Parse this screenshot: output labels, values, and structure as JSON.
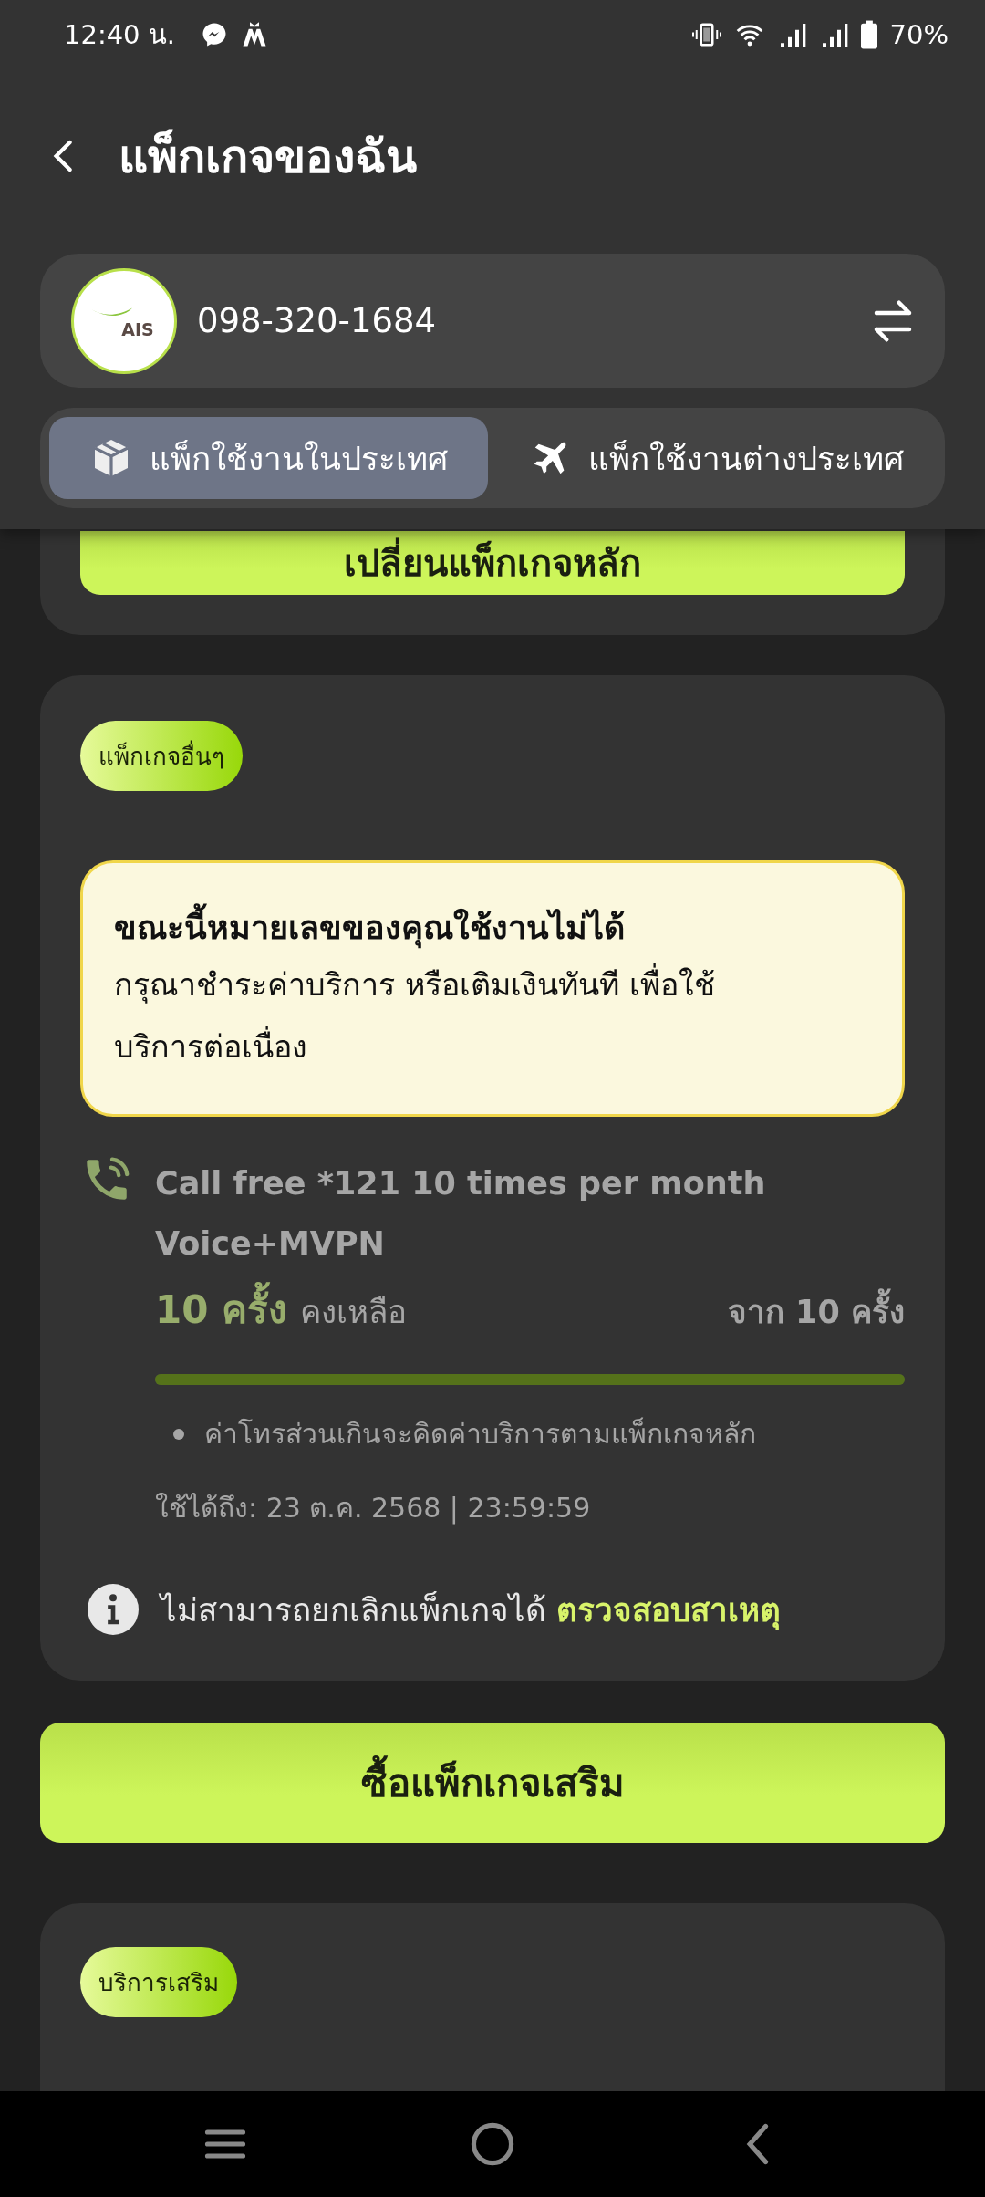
{
  "status_bar": {
    "time": "12:40 น.",
    "battery": "70%"
  },
  "header": {
    "title": "แพ็กเกจของฉัน"
  },
  "account": {
    "logo_text": "AIS",
    "phone": "098-320-1684"
  },
  "tabs": [
    {
      "label": "แพ็กใช้งานในประเทศ",
      "selected": true
    },
    {
      "label": "แพ็กใช้งานต่างประเทศ",
      "selected": false
    }
  ],
  "main_package_button": "เปลี่ยนแพ็กเกจหลัก",
  "other_packages": {
    "badge": "แพ็กเกจอื่นๆ",
    "alert": {
      "title": "ขณะนี้หมายเลขของคุณใช้งานไม่ได้",
      "message": "กรุณาชำระค่าบริการ หรือเติมเงินทันที เพื่อใช้บริการต่อเนื่อง"
    },
    "package": {
      "name": "Call free *121 10 times per month",
      "type": "Voice+MVPN",
      "remaining": "10 ครั้ง",
      "remaining_label": "คงเหลือ",
      "total": "จาก 10 ครั้ง",
      "level": 1,
      "notes": [
        "ค่าโทรส่วนเกินจะคิดค่าบริการตามแพ็กเกจหลัก"
      ],
      "valid_until": "ใช้ได้ถึง: 23 ต.ค. 2568 | 23:59:59"
    },
    "cancel_note": {
      "text": "ไม่สามารถยกเลิกแพ็กเกจได้",
      "link": "ตรวจสอบสาเหตุ"
    }
  },
  "buy_button": "ซื้อแพ็กเกจเสริม",
  "addons": {
    "badge": "บริการเสริม"
  }
}
